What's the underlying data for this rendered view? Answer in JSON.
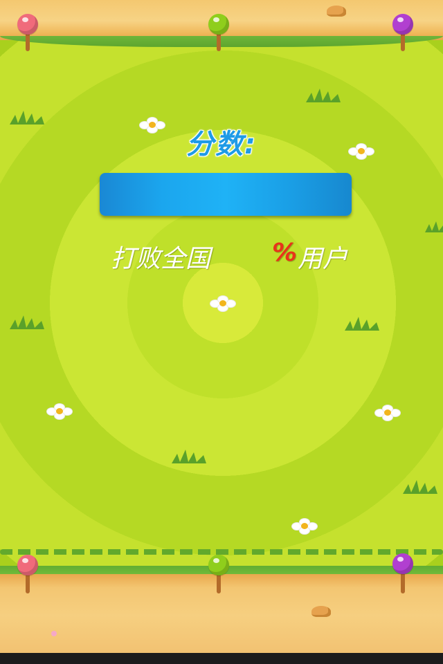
{
  "screen": {
    "score_label": "分数:",
    "score_value": "",
    "defeat_prefix": "打败全国",
    "defeat_percent_value": "",
    "defeat_percent_sign": "%",
    "defeat_suffix": "用户"
  },
  "colors": {
    "score_label": "#1e9be6",
    "score_bar": "#1ba6ee",
    "percent_sign": "#e8341a",
    "grass": "#b5d924",
    "sand": "#f4c870"
  },
  "decorations": {
    "posts": [
      "pink-lollipop",
      "green-lollipop",
      "purple-lollipop"
    ],
    "icons": [
      "flower-icon",
      "grass-tuft-icon",
      "rock-icon"
    ]
  }
}
